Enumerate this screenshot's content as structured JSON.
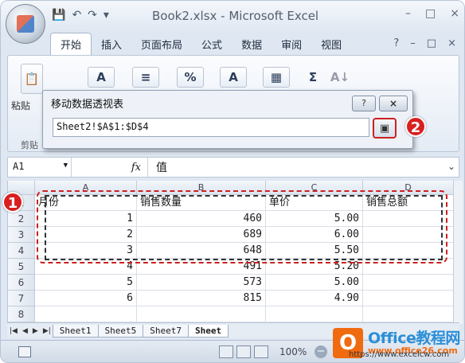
{
  "window": {
    "title": "Book2.xlsx - Microsoft Excel",
    "controls": [
      "–",
      "□",
      "×"
    ]
  },
  "qat": {
    "save": "💾",
    "undo": "↶",
    "redo": "↷",
    "more": "▾"
  },
  "ribbon": {
    "tabs": [
      "开始",
      "插入",
      "页面布局",
      "公式",
      "数据",
      "审阅",
      "视图"
    ],
    "active_tab": "开始",
    "right_icons": [
      "?",
      "–",
      "□",
      "×"
    ],
    "paste_label": "粘贴",
    "clipboard_label": "剪贴",
    "buttons": [
      "A",
      "≡",
      "%",
      "A",
      "▦",
      "Σ",
      "A↓"
    ]
  },
  "dialog": {
    "title": "移动数据透视表",
    "help_label": "?",
    "close_label": "×",
    "range_value": "Sheet2!$A$1:$D$4",
    "collapse_label": "▣"
  },
  "badges": {
    "one": "1",
    "two": "2"
  },
  "formula_bar": {
    "name_box": "A1",
    "fx_label": "fx",
    "value": "值"
  },
  "grid": {
    "columns": [
      "A",
      "B",
      "C",
      "D"
    ],
    "rows": [
      {
        "num": "1",
        "cells": [
          "月份",
          "销售数量",
          "单价",
          "销售总额"
        ]
      },
      {
        "num": "2",
        "cells": [
          "1",
          "460",
          "5.00",
          ""
        ]
      },
      {
        "num": "3",
        "cells": [
          "2",
          "689",
          "6.00",
          ""
        ]
      },
      {
        "num": "4",
        "cells": [
          "3",
          "648",
          "5.50",
          ""
        ]
      },
      {
        "num": "5",
        "cells": [
          "4",
          "491",
          "5.20",
          ""
        ]
      },
      {
        "num": "6",
        "cells": [
          "5",
          "573",
          "5.00",
          ""
        ]
      },
      {
        "num": "7",
        "cells": [
          "6",
          "815",
          "4.90",
          ""
        ]
      },
      {
        "num": "8",
        "cells": [
          "",
          "",
          "",
          ""
        ]
      }
    ]
  },
  "sheets": {
    "tabs": [
      "Sheet1",
      "Sheet5",
      "Sheet7",
      "Sheet"
    ],
    "active": "Sheet"
  },
  "status": {
    "zoom": "100%"
  },
  "watermark": {
    "logo": "O",
    "brand": "Office教程网",
    "url": "www.office26.com",
    "url2": "https://www.excelcw.com"
  }
}
